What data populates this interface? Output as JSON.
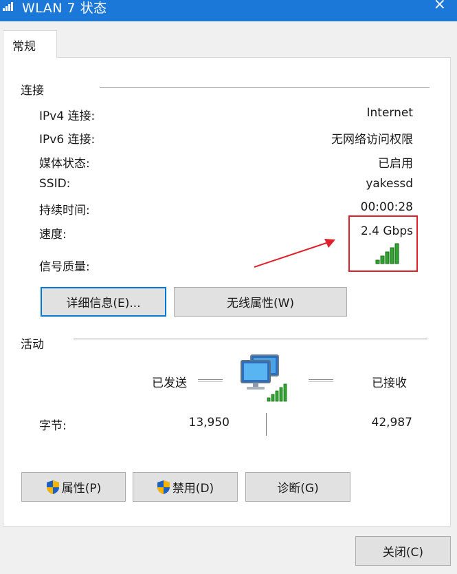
{
  "window": {
    "title": "WLAN 7 状态",
    "close_glyph": "×"
  },
  "tabs": [
    {
      "label": "常规"
    }
  ],
  "connection": {
    "section_label": "连接",
    "rows": [
      {
        "label": "IPv4 连接:",
        "value": "Internet"
      },
      {
        "label": "IPv6 连接:",
        "value": "无网络访问权限"
      },
      {
        "label": "媒体状态:",
        "value": "已启用"
      },
      {
        "label": "SSID:",
        "value": "yakessd"
      },
      {
        "label": "持续时间:",
        "value": "00:00:28"
      },
      {
        "label": "速度:",
        "value": "2.4 Gbps"
      }
    ],
    "signal_label": "信号质量:",
    "signal_bars": 5,
    "details_button": "详细信息(E)...",
    "wireless_props_button": "无线属性(W)"
  },
  "activity": {
    "section_label": "活动",
    "sent_label": "已发送",
    "received_label": "已接收",
    "bytes_label": "字节:",
    "bytes_sent": "13,950",
    "bytes_received": "42,987"
  },
  "actions": {
    "properties_button": "属性(P)",
    "disable_button": "禁用(D)",
    "diagnose_button": "诊断(G)"
  },
  "footer": {
    "close_button": "关闭(C)"
  },
  "colors": {
    "titlebar": "#1b78d8",
    "signal": "#2fa42f",
    "annotation": "#e0202b",
    "focus_border": "#0078d7"
  }
}
